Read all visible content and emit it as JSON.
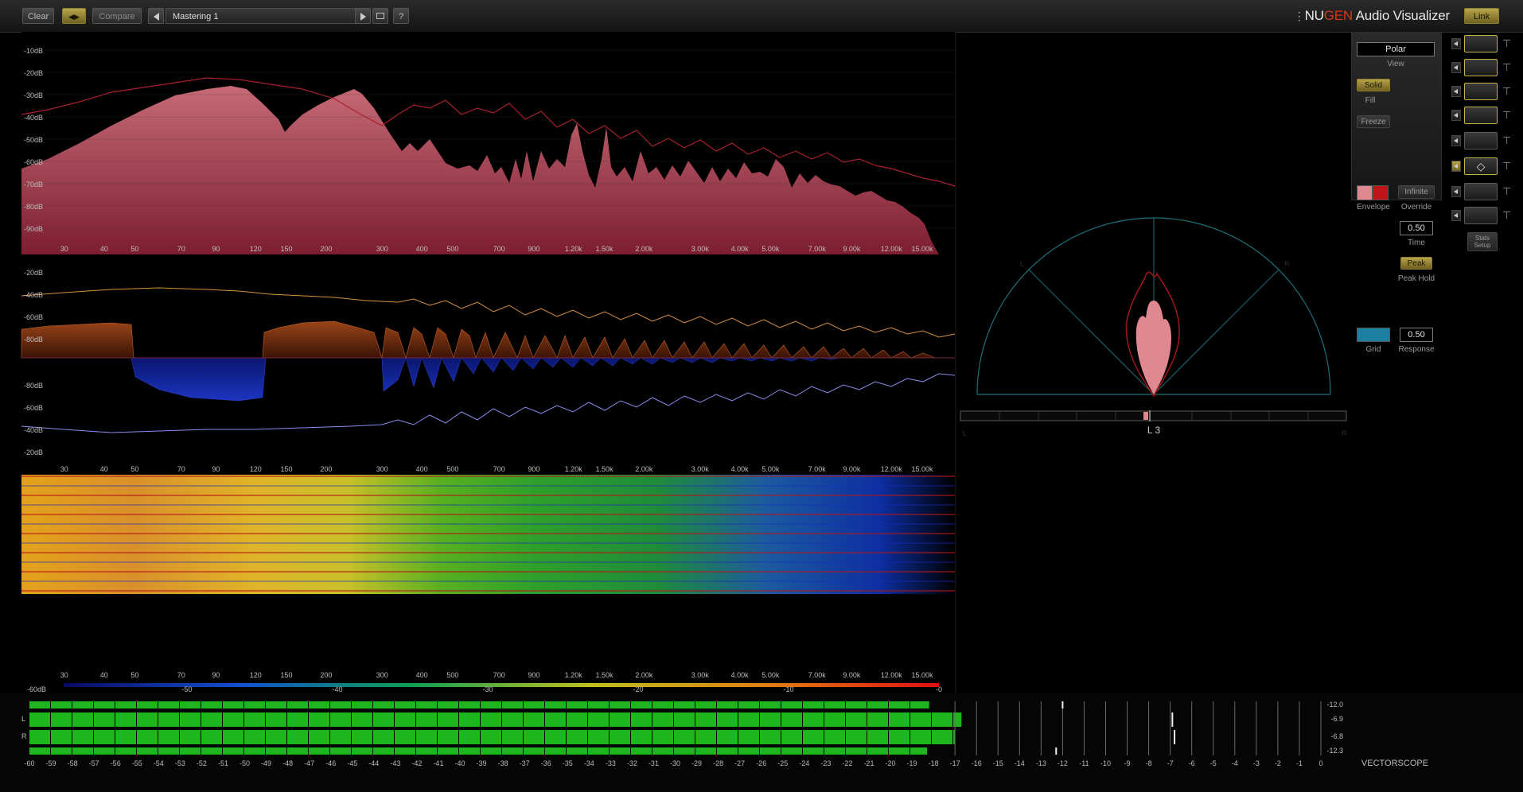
{
  "toolbar": {
    "clear_label": "Clear",
    "ab_label": "◀▶",
    "compare_label": "Compare",
    "preset_name": "Mastering 1",
    "help_label": "?"
  },
  "brand": {
    "nu": "NU",
    "gen": "GEN",
    "product": " Audio Visualizer",
    "link_label": "Link"
  },
  "spectrum": {
    "db_labels": [
      "-10dB",
      "-20dB",
      "-30dB",
      "-40dB",
      "-50dB",
      "-60dB",
      "-70dB",
      "-80dB",
      "-90dB"
    ],
    "freq_labels": [
      "30",
      "40",
      "50",
      "70",
      "90",
      "120",
      "150",
      "200",
      "300",
      "400",
      "500",
      "700",
      "900",
      "1.20k",
      "1.50k",
      "2.00k",
      "3.00k",
      "4.00k",
      "5.00k",
      "7.00k",
      "9.00k",
      "12.00k",
      "15.00k"
    ]
  },
  "stereo_spectrum": {
    "db_labels_top": [
      "-20dB",
      "-40dB",
      "-60dB",
      "-80dB"
    ],
    "db_labels_bottom": [
      "-80dB",
      "-60dB",
      "-40dB",
      "-20dB"
    ]
  },
  "sonogram": {
    "scale_labels": [
      "-60dB",
      "-50",
      "-40",
      "-30",
      "-20",
      "-10",
      "-0"
    ]
  },
  "vectorscope": {
    "l_label": "L",
    "r_label": "R",
    "balance_readout": "L 3",
    "bottom_l": "L",
    "bottom_r": "R",
    "mode_label": "VECTORSCOPE"
  },
  "controls": {
    "view_value": "Polar",
    "view_label": "View",
    "fill_button": "Solid",
    "fill_label": "Fill",
    "freeze_button": "Freeze",
    "envelope_label": "Envelope",
    "infinite_button": "Infinite",
    "override_label": "Override",
    "time_value": "0.50",
    "time_label": "Time",
    "peak_button": "Peak",
    "peak_hold_label": "Peak Hold",
    "grid_label": "Grid",
    "response_value": "0.50",
    "response_label": "Response",
    "stats_setup_label": "Stats Setup",
    "envelope_colors": [
      "#e08890",
      "#c01418"
    ],
    "grid_color": "#1a7fa0"
  },
  "meter": {
    "channel_labels": [
      "L",
      "R"
    ],
    "readouts": [
      "-12.0",
      "-6.9",
      "-6.8",
      "-12.3"
    ],
    "scale_labels": [
      "-60",
      "-59",
      "-58",
      "-57",
      "-56",
      "-55",
      "-54",
      "-53",
      "-52",
      "-51",
      "-50",
      "-49",
      "-48",
      "-47",
      "-46",
      "-45",
      "-44",
      "-43",
      "-42",
      "-41",
      "-40",
      "-39",
      "-38",
      "-37",
      "-36",
      "-35",
      "-34",
      "-33",
      "-32",
      "-31",
      "-30",
      "-29",
      "-28",
      "-27",
      "-26",
      "-25",
      "-24",
      "-23",
      "-22",
      "-21",
      "-20",
      "-19",
      "-18",
      "-17",
      "-16",
      "-15",
      "-14",
      "-13",
      "-12",
      "-11",
      "-10",
      "-9",
      "-8",
      "-7",
      "-6",
      "-5",
      "-4",
      "-3",
      "-2",
      "-1",
      "0"
    ],
    "levels_db": [
      -12.0,
      -6.9,
      -6.8,
      -12.3
    ],
    "bar_levels_db": [
      -18.2,
      -16.7,
      -17.0,
      -18.3
    ]
  },
  "side_icons": [
    "spectrum-icon",
    "bars-icon",
    "stereo-spectrum-icon",
    "sonogram-icon",
    "stereo-sonogram-icon",
    "vectorscope-icon",
    "meter-icon",
    "balance-icon"
  ]
}
